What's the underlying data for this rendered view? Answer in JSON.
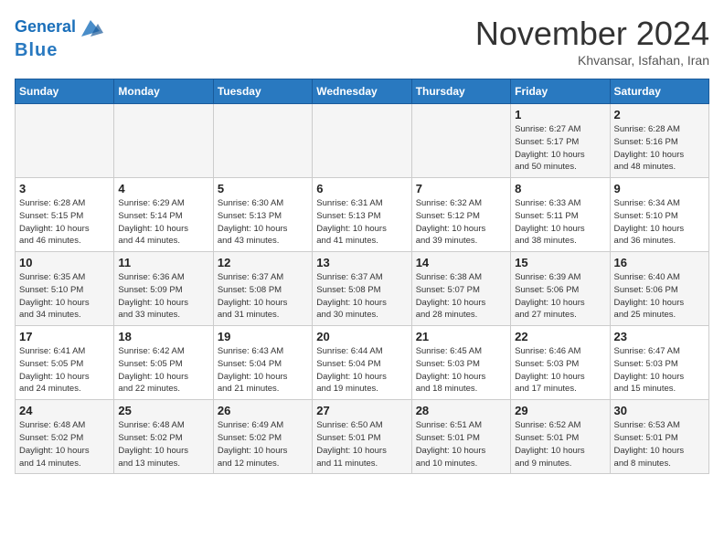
{
  "header": {
    "logo_line1": "General",
    "logo_line2": "Blue",
    "month_title": "November 2024",
    "location": "Khvansar, Isfahan, Iran"
  },
  "days_of_week": [
    "Sunday",
    "Monday",
    "Tuesday",
    "Wednesday",
    "Thursday",
    "Friday",
    "Saturday"
  ],
  "weeks": [
    [
      {
        "day": "",
        "info": ""
      },
      {
        "day": "",
        "info": ""
      },
      {
        "day": "",
        "info": ""
      },
      {
        "day": "",
        "info": ""
      },
      {
        "day": "",
        "info": ""
      },
      {
        "day": "1",
        "info": "Sunrise: 6:27 AM\nSunset: 5:17 PM\nDaylight: 10 hours\nand 50 minutes."
      },
      {
        "day": "2",
        "info": "Sunrise: 6:28 AM\nSunset: 5:16 PM\nDaylight: 10 hours\nand 48 minutes."
      }
    ],
    [
      {
        "day": "3",
        "info": "Sunrise: 6:28 AM\nSunset: 5:15 PM\nDaylight: 10 hours\nand 46 minutes."
      },
      {
        "day": "4",
        "info": "Sunrise: 6:29 AM\nSunset: 5:14 PM\nDaylight: 10 hours\nand 44 minutes."
      },
      {
        "day": "5",
        "info": "Sunrise: 6:30 AM\nSunset: 5:13 PM\nDaylight: 10 hours\nand 43 minutes."
      },
      {
        "day": "6",
        "info": "Sunrise: 6:31 AM\nSunset: 5:13 PM\nDaylight: 10 hours\nand 41 minutes."
      },
      {
        "day": "7",
        "info": "Sunrise: 6:32 AM\nSunset: 5:12 PM\nDaylight: 10 hours\nand 39 minutes."
      },
      {
        "day": "8",
        "info": "Sunrise: 6:33 AM\nSunset: 5:11 PM\nDaylight: 10 hours\nand 38 minutes."
      },
      {
        "day": "9",
        "info": "Sunrise: 6:34 AM\nSunset: 5:10 PM\nDaylight: 10 hours\nand 36 minutes."
      }
    ],
    [
      {
        "day": "10",
        "info": "Sunrise: 6:35 AM\nSunset: 5:10 PM\nDaylight: 10 hours\nand 34 minutes."
      },
      {
        "day": "11",
        "info": "Sunrise: 6:36 AM\nSunset: 5:09 PM\nDaylight: 10 hours\nand 33 minutes."
      },
      {
        "day": "12",
        "info": "Sunrise: 6:37 AM\nSunset: 5:08 PM\nDaylight: 10 hours\nand 31 minutes."
      },
      {
        "day": "13",
        "info": "Sunrise: 6:37 AM\nSunset: 5:08 PM\nDaylight: 10 hours\nand 30 minutes."
      },
      {
        "day": "14",
        "info": "Sunrise: 6:38 AM\nSunset: 5:07 PM\nDaylight: 10 hours\nand 28 minutes."
      },
      {
        "day": "15",
        "info": "Sunrise: 6:39 AM\nSunset: 5:06 PM\nDaylight: 10 hours\nand 27 minutes."
      },
      {
        "day": "16",
        "info": "Sunrise: 6:40 AM\nSunset: 5:06 PM\nDaylight: 10 hours\nand 25 minutes."
      }
    ],
    [
      {
        "day": "17",
        "info": "Sunrise: 6:41 AM\nSunset: 5:05 PM\nDaylight: 10 hours\nand 24 minutes."
      },
      {
        "day": "18",
        "info": "Sunrise: 6:42 AM\nSunset: 5:05 PM\nDaylight: 10 hours\nand 22 minutes."
      },
      {
        "day": "19",
        "info": "Sunrise: 6:43 AM\nSunset: 5:04 PM\nDaylight: 10 hours\nand 21 minutes."
      },
      {
        "day": "20",
        "info": "Sunrise: 6:44 AM\nSunset: 5:04 PM\nDaylight: 10 hours\nand 19 minutes."
      },
      {
        "day": "21",
        "info": "Sunrise: 6:45 AM\nSunset: 5:03 PM\nDaylight: 10 hours\nand 18 minutes."
      },
      {
        "day": "22",
        "info": "Sunrise: 6:46 AM\nSunset: 5:03 PM\nDaylight: 10 hours\nand 17 minutes."
      },
      {
        "day": "23",
        "info": "Sunrise: 6:47 AM\nSunset: 5:03 PM\nDaylight: 10 hours\nand 15 minutes."
      }
    ],
    [
      {
        "day": "24",
        "info": "Sunrise: 6:48 AM\nSunset: 5:02 PM\nDaylight: 10 hours\nand 14 minutes."
      },
      {
        "day": "25",
        "info": "Sunrise: 6:48 AM\nSunset: 5:02 PM\nDaylight: 10 hours\nand 13 minutes."
      },
      {
        "day": "26",
        "info": "Sunrise: 6:49 AM\nSunset: 5:02 PM\nDaylight: 10 hours\nand 12 minutes."
      },
      {
        "day": "27",
        "info": "Sunrise: 6:50 AM\nSunset: 5:01 PM\nDaylight: 10 hours\nand 11 minutes."
      },
      {
        "day": "28",
        "info": "Sunrise: 6:51 AM\nSunset: 5:01 PM\nDaylight: 10 hours\nand 10 minutes."
      },
      {
        "day": "29",
        "info": "Sunrise: 6:52 AM\nSunset: 5:01 PM\nDaylight: 10 hours\nand 9 minutes."
      },
      {
        "day": "30",
        "info": "Sunrise: 6:53 AM\nSunset: 5:01 PM\nDaylight: 10 hours\nand 8 minutes."
      }
    ]
  ]
}
